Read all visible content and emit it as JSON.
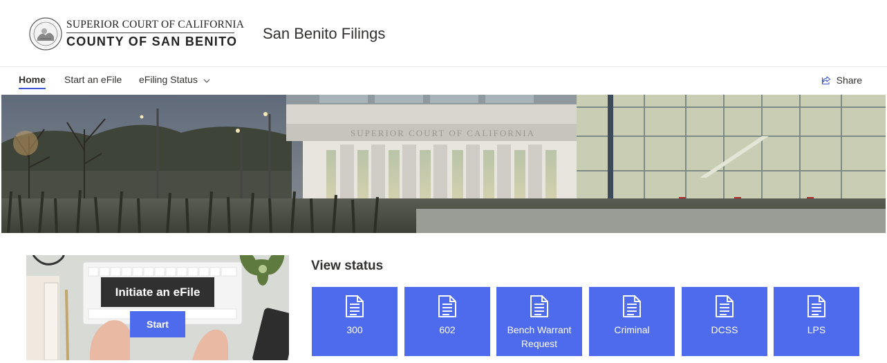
{
  "header": {
    "logo_line1": "SUPERIOR COURT OF CALIFORNIA",
    "logo_line2": "COUNTY OF SAN BENITO",
    "site_title": "San Benito Filings"
  },
  "nav": {
    "items": [
      {
        "label": "Home",
        "active": true
      },
      {
        "label": "Start an eFile"
      },
      {
        "label": "eFiling Status",
        "icon": "chevron-down-icon"
      }
    ],
    "share_label": "Share",
    "share_icon": "share-icon"
  },
  "hero": {
    "building_sign": "SUPERIOR COURT OF CALIFORNIA"
  },
  "efile_tile": {
    "caption": "Initiate an eFile",
    "button_label": "Start"
  },
  "view_status": {
    "title": "View status",
    "buttons": [
      {
        "label": "300",
        "icon": "document-icon"
      },
      {
        "label": "602",
        "icon": "document-icon"
      },
      {
        "label": "Bench Warrant Request",
        "icon": "document-icon"
      },
      {
        "label": "Criminal",
        "icon": "document-icon"
      },
      {
        "label": "DCSS",
        "icon": "document-icon"
      },
      {
        "label": "LPS",
        "icon": "document-icon"
      }
    ]
  },
  "colors": {
    "accent": "#4f6bed",
    "nav_underline": "#3a56d4",
    "text": "#323130"
  }
}
